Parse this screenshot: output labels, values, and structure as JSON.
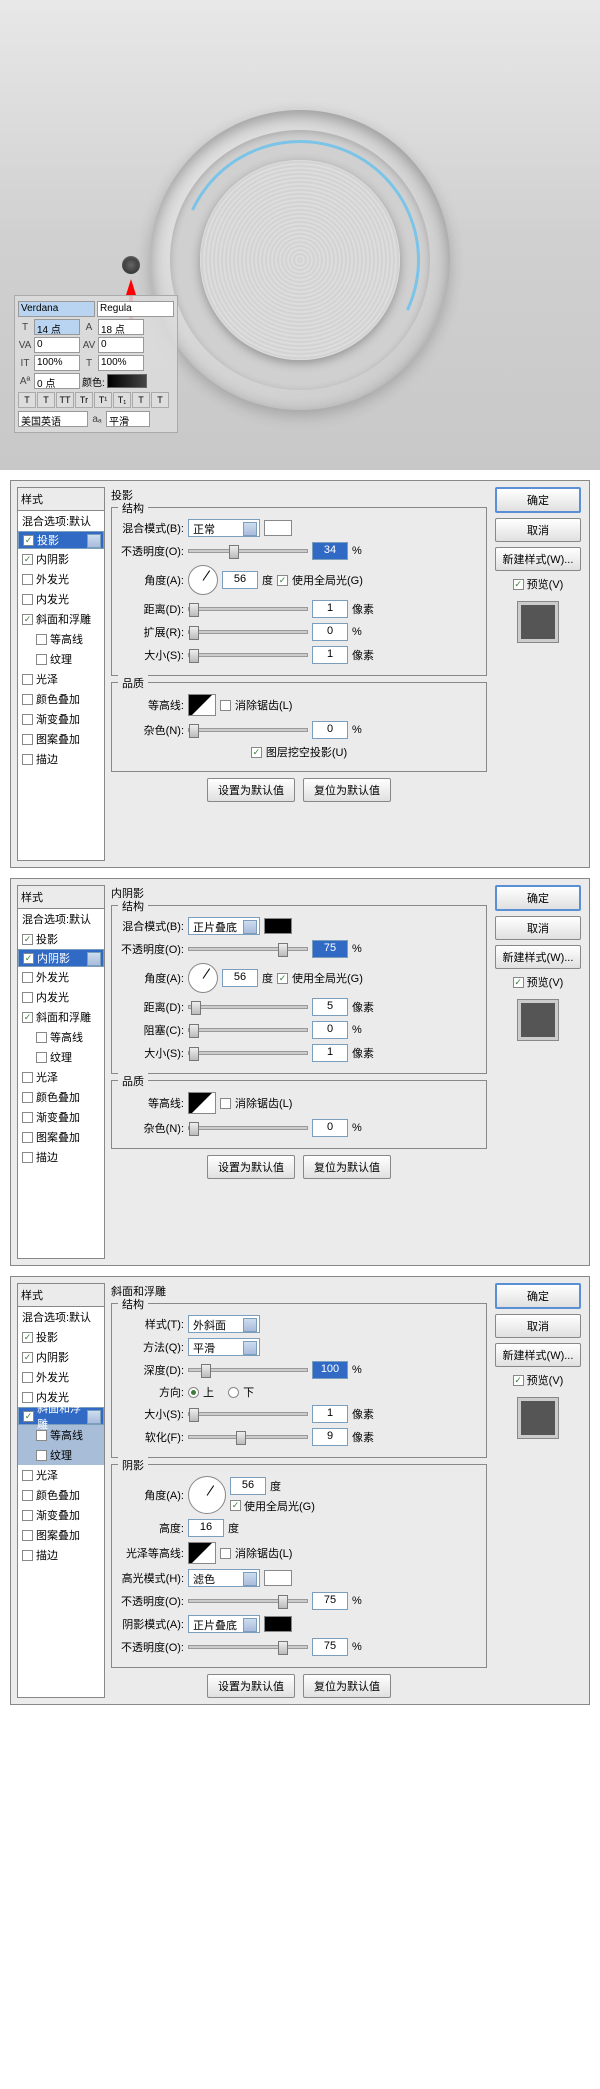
{
  "char_panel": {
    "font": "Verdana",
    "style": "Regula",
    "size_icon": "T",
    "size": "14 点",
    "leading_icon": "A",
    "leading": "18 点",
    "va": "VA",
    "va_val": "0",
    "va2": "0",
    "it": "IT",
    "h_scale": "100%",
    "t_bold": "T",
    "v_scale": "100%",
    "baseline_icon": "Aª",
    "baseline": "0 点",
    "color_label": "颜色:",
    "btns": [
      "T",
      "T",
      "TT",
      "Tr",
      "T¹",
      "T₁",
      "T",
      "T"
    ],
    "lang": "美国英语",
    "aa_icon": "aₐ",
    "aa": "平滑"
  },
  "common": {
    "styles_title": "样式",
    "blend_default": "混合选项:默认",
    "drop_shadow": "投影",
    "inner_shadow": "内阴影",
    "outer_glow": "外发光",
    "inner_glow": "内发光",
    "bevel": "斜面和浮雕",
    "contour_sub": "等高线",
    "texture_sub": "纹理",
    "satin": "光泽",
    "color_overlay": "颜色叠加",
    "gradient_overlay": "渐变叠加",
    "pattern_overlay": "图案叠加",
    "stroke": "描边",
    "ok": "确定",
    "cancel": "取消",
    "new_style": "新建样式(W)...",
    "preview": "预览(V)",
    "structure": "结构",
    "quality": "品质",
    "shadow": "阴影",
    "blend_mode": "混合模式(B):",
    "opacity": "不透明度(O):",
    "angle": "角度(A):",
    "deg": "度",
    "global_light": "使用全局光(G)",
    "distance": "距离(D):",
    "px": "像素",
    "spread": "扩展(R):",
    "choke": "阻塞(C):",
    "size": "大小(S):",
    "contour": "等高线:",
    "antialias": "消除锯齿(L)",
    "noise": "杂色(N):",
    "knockout": "图层挖空投影(U)",
    "make_default": "设置为默认值",
    "reset_default": "复位为默认值",
    "pct": "%",
    "style_lbl": "样式(T):",
    "technique": "方法(Q):",
    "depth": "深度(D):",
    "direction": "方向:",
    "up": "上",
    "down": "下",
    "soften": "软化(F):",
    "altitude": "高度:",
    "gloss_contour": "光泽等高线:",
    "highlight_mode": "高光模式(H):",
    "shadow_mode": "阴影模式(A):"
  },
  "d1": {
    "title": "投影",
    "blend": "正常",
    "opacity": "34",
    "angle": "56",
    "distance": "1",
    "spread": "0",
    "size": "1",
    "noise": "0"
  },
  "d2": {
    "title": "内阴影",
    "blend": "正片叠底",
    "opacity": "75",
    "angle": "56",
    "distance": "5",
    "choke": "0",
    "size": "1",
    "noise": "0"
  },
  "d3": {
    "title": "斜面和浮雕",
    "style": "外斜面",
    "technique": "平滑",
    "depth": "100",
    "size": "1",
    "soften": "9",
    "angle": "56",
    "altitude": "16",
    "highlight": "滤色",
    "h_opacity": "75",
    "shadow": "正片叠底",
    "s_opacity": "75"
  }
}
